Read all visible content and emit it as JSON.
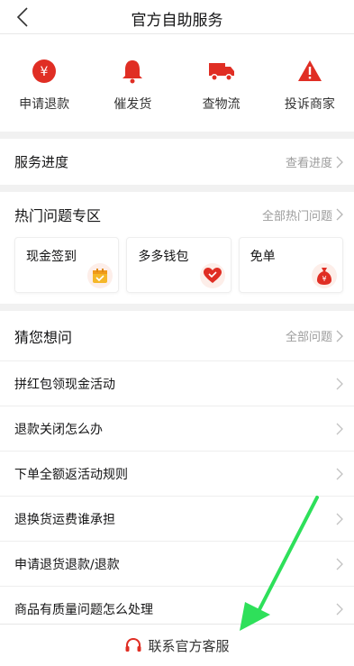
{
  "header": {
    "title": "官方自助服务"
  },
  "quick_actions": [
    {
      "label": "申请退款",
      "icon": "yuan-icon"
    },
    {
      "label": "催发货",
      "icon": "bell-icon"
    },
    {
      "label": "查物流",
      "icon": "truck-icon"
    },
    {
      "label": "投诉商家",
      "icon": "warning-icon"
    }
  ],
  "service_progress": {
    "title": "服务进度",
    "link": "查看进度"
  },
  "hot_issues": {
    "title": "热门问题专区",
    "link": "全部热门问题",
    "cards": [
      {
        "label": "现金签到",
        "icon": "calendar-icon"
      },
      {
        "label": "多多钱包",
        "icon": "heart-wallet-icon"
      },
      {
        "label": "免单",
        "icon": "money-bag-icon"
      }
    ]
  },
  "guess": {
    "title": "猜您想问",
    "link": "全部问题",
    "items": [
      "拼红包领现金活动",
      "退款关闭怎么办",
      "下单全额返活动规则",
      "退换货运费谁承担",
      "申请退货退款/退款",
      "商品有质量问题怎么处理"
    ]
  },
  "footer": {
    "contact_label": "联系官方客服"
  },
  "colors": {
    "accent": "#e02e24",
    "annotation_arrow": "#2ee05a"
  }
}
